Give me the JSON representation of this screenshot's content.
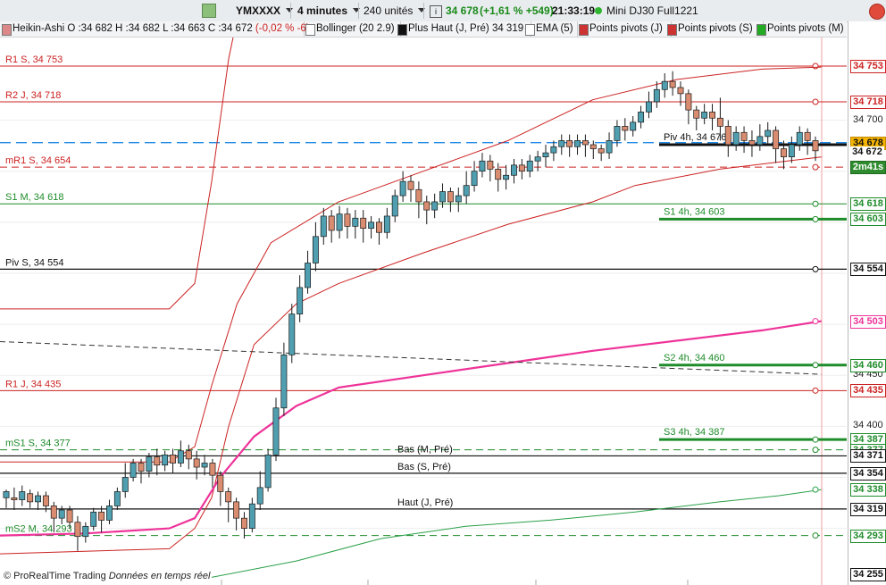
{
  "toolbar": {
    "symbol": "YMXXXX",
    "timeframe": "4 minutes",
    "units": "240 unités",
    "price": "34 678",
    "change": "(+1,61 % +549)",
    "time": "21:33:19",
    "contract": "Mini DJ30 Full1221"
  },
  "indicators": {
    "ha": "Heikin-Ashi O :34 682 H :34 682 L :34 663 C :34 672",
    "ha_change": "(-0,02 % -6)",
    "bollinger": "Bollinger (20 2.9)",
    "plus_haut": "Plus Haut (J, Pré)  34 319",
    "ema": "EMA (5)",
    "pivots_j": "Points pivots (J)",
    "pivots_s": "Points pivots (S)",
    "pivots_m": "Points pivots (M)"
  },
  "footer": {
    "brand": "© ProRealTime Trading",
    "data": "Données en temps réel"
  },
  "colors": {
    "up": "#4f9fb0",
    "down": "#d98c70",
    "red": "#cc2222",
    "green": "#1e8c2a",
    "magenta": "#ee3399",
    "blue": "#1f88e5"
  },
  "chart_data": {
    "type": "candlestick",
    "ylim": [
      34248,
      34790
    ],
    "y_ticks": [
      34700,
      34450,
      34400
    ],
    "levels": [
      {
        "label": "R1 S, 34 753",
        "value": 34753,
        "color": "red",
        "style": "solid"
      },
      {
        "label": "R2 J, 34 718",
        "value": 34718,
        "color": "red",
        "style": "solid"
      },
      {
        "label": "mR1 S, 34 654",
        "value": 34654,
        "color": "red",
        "style": "dashed"
      },
      {
        "label": "S1 M, 34 618",
        "value": 34618,
        "color": "green",
        "style": "solid"
      },
      {
        "label": "Piv S, 34 554",
        "value": 34554,
        "color": "black",
        "style": "solid"
      },
      {
        "label": "R1 J, 34 435",
        "value": 34435,
        "color": "red",
        "style": "solid"
      },
      {
        "label": "mS1 S, 34 377",
        "value": 34377,
        "color": "green",
        "style": "dashed"
      },
      {
        "label": "mS2 M, 34 293",
        "value": 34293,
        "color": "green",
        "style": "dashed"
      },
      {
        "label": "Bas (M, Pré)",
        "value": 34371,
        "color": "black",
        "style": "solid"
      },
      {
        "label": "Bas (S, Pré)",
        "value": 34354,
        "color": "black",
        "style": "solid"
      },
      {
        "label": "Haut (J, Pré)",
        "value": 34319,
        "color": "black",
        "style": "solid"
      }
    ],
    "pivots_4h": [
      {
        "label": "Piv 4h, 34 676",
        "value": 34676,
        "color": "black"
      },
      {
        "label": "S1 4h, 34 603",
        "value": 34603,
        "color": "green"
      },
      {
        "label": "S2 4h, 34 460",
        "value": 34460,
        "color": "green"
      },
      {
        "label": "S3 4h, 34 387",
        "value": 34387,
        "color": "green"
      }
    ],
    "axis_boxes": [
      {
        "text": "34 753",
        "value": 34753,
        "kind": "red"
      },
      {
        "text": "34 718",
        "value": 34718,
        "kind": "red"
      },
      {
        "text": "34 678",
        "value": 34678,
        "kind": "price"
      },
      {
        "text": "34 672",
        "value": 34668,
        "kind": "plain"
      },
      {
        "text": "2m41s",
        "value": 34654,
        "kind": "timer"
      },
      {
        "text": "34 618",
        "value": 34618,
        "kind": "green"
      },
      {
        "text": "34 603",
        "value": 34603,
        "kind": "green"
      },
      {
        "text": "34 554",
        "value": 34554,
        "kind": "black"
      },
      {
        "text": "34 503",
        "value": 34503,
        "kind": "magenta"
      },
      {
        "text": "34 460",
        "value": 34460,
        "kind": "green"
      },
      {
        "text": "34 435",
        "value": 34435,
        "kind": "red"
      },
      {
        "text": "34 387",
        "value": 34387,
        "kind": "green"
      },
      {
        "text": "34 377",
        "value": 34377,
        "kind": "green"
      },
      {
        "text": "34 371",
        "value": 34371,
        "kind": "black"
      },
      {
        "text": "34 354",
        "value": 34354,
        "kind": "black"
      },
      {
        "text": "34 338",
        "value": 34338,
        "kind": "green"
      },
      {
        "text": "34 319",
        "value": 34319,
        "kind": "black"
      },
      {
        "text": "34 293",
        "value": 34293,
        "kind": "green"
      },
      {
        "text": "34 255",
        "value": 34255,
        "kind": "black"
      }
    ],
    "candles": [
      [
        34330,
        34336,
        34320,
        34338
      ],
      [
        34330,
        34328,
        34318,
        34340
      ],
      [
        34328,
        34336,
        34322,
        34342
      ],
      [
        34334,
        34326,
        34320,
        34338
      ],
      [
        34326,
        34332,
        34318,
        34336
      ],
      [
        34332,
        34322,
        34316,
        34336
      ],
      [
        34322,
        34310,
        34296,
        34326
      ],
      [
        34310,
        34318,
        34304,
        34322
      ],
      [
        34318,
        34306,
        34300,
        34322
      ],
      [
        34306,
        34292,
        34278,
        34312
      ],
      [
        34292,
        34302,
        34286,
        34306
      ],
      [
        34302,
        34316,
        34298,
        34320
      ],
      [
        34316,
        34308,
        34296,
        34322
      ],
      [
        34308,
        34322,
        34304,
        34328
      ],
      [
        34322,
        34336,
        34318,
        34340
      ],
      [
        34336,
        34350,
        34330,
        34364
      ],
      [
        34350,
        34364,
        34346,
        34368
      ],
      [
        34364,
        34356,
        34344,
        34368
      ],
      [
        34356,
        34370,
        34350,
        34374
      ],
      [
        34370,
        34362,
        34352,
        34378
      ],
      [
        34362,
        34372,
        34356,
        34376
      ],
      [
        34372,
        34364,
        34354,
        34378
      ],
      [
        34364,
        34376,
        34360,
        34386
      ],
      [
        34376,
        34368,
        34358,
        34382
      ],
      [
        34368,
        34360,
        34348,
        34376
      ],
      [
        34360,
        34364,
        34352,
        34372
      ],
      [
        34364,
        34352,
        34340,
        34368
      ],
      [
        34352,
        34336,
        34322,
        34356
      ],
      [
        34336,
        34326,
        34306,
        34340
      ],
      [
        34326,
        34310,
        34298,
        34330
      ],
      [
        34310,
        34300,
        34290,
        34316
      ],
      [
        34300,
        34324,
        34296,
        34330
      ],
      [
        34324,
        34340,
        34318,
        34356
      ],
      [
        34340,
        34372,
        34336,
        34378
      ],
      [
        34372,
        34418,
        34366,
        34428
      ],
      [
        34418,
        34470,
        34410,
        34482
      ],
      [
        34470,
        34510,
        34462,
        34520
      ],
      [
        34510,
        34536,
        34502,
        34548
      ],
      [
        34536,
        34560,
        34530,
        34572
      ],
      [
        34560,
        34586,
        34552,
        34600
      ],
      [
        34586,
        34606,
        34578,
        34614
      ],
      [
        34606,
        34592,
        34580,
        34612
      ],
      [
        34592,
        34608,
        34584,
        34616
      ],
      [
        34608,
        34596,
        34584,
        34614
      ],
      [
        34596,
        34604,
        34584,
        34612
      ],
      [
        34604,
        34594,
        34580,
        34612
      ],
      [
        34594,
        34600,
        34584,
        34606
      ],
      [
        34600,
        34590,
        34578,
        34604
      ],
      [
        34590,
        34606,
        34584,
        34614
      ],
      [
        34606,
        34626,
        34600,
        34632
      ],
      [
        34626,
        34640,
        34620,
        34650
      ],
      [
        34640,
        34632,
        34620,
        34646
      ],
      [
        34632,
        34620,
        34604,
        34640
      ],
      [
        34620,
        34612,
        34598,
        34626
      ],
      [
        34612,
        34620,
        34604,
        34628
      ],
      [
        34620,
        34630,
        34614,
        34638
      ],
      [
        34630,
        34620,
        34610,
        34634
      ],
      [
        34620,
        34626,
        34610,
        34634
      ],
      [
        34626,
        34636,
        34618,
        34650
      ],
      [
        34636,
        34650,
        34630,
        34660
      ],
      [
        34650,
        34660,
        34644,
        34668
      ],
      [
        34660,
        34652,
        34640,
        34666
      ],
      [
        34652,
        34642,
        34630,
        34658
      ],
      [
        34642,
        34646,
        34632,
        34656
      ],
      [
        34646,
        34656,
        34638,
        34662
      ],
      [
        34656,
        34650,
        34642,
        34662
      ],
      [
        34650,
        34660,
        34644,
        34666
      ],
      [
        34660,
        34664,
        34650,
        34670
      ],
      [
        34664,
        34668,
        34654,
        34676
      ],
      [
        34668,
        34674,
        34660,
        34680
      ],
      [
        34674,
        34680,
        34666,
        34686
      ],
      [
        34680,
        34674,
        34664,
        34686
      ],
      [
        34674,
        34680,
        34666,
        34686
      ],
      [
        34680,
        34676,
        34664,
        34686
      ],
      [
        34676,
        34672,
        34662,
        34680
      ],
      [
        34672,
        34668,
        34660,
        34676
      ],
      [
        34668,
        34680,
        34662,
        34688
      ],
      [
        34680,
        34694,
        34674,
        34700
      ],
      [
        34694,
        34690,
        34680,
        34702
      ],
      [
        34690,
        34698,
        34684,
        34704
      ],
      [
        34698,
        34708,
        34692,
        34714
      ],
      [
        34708,
        34718,
        34702,
        34728
      ],
      [
        34718,
        34730,
        34712,
        34738
      ],
      [
        34730,
        34738,
        34722,
        34746
      ],
      [
        34738,
        34732,
        34724,
        34748
      ],
      [
        34732,
        34726,
        34714,
        34738
      ],
      [
        34726,
        34710,
        34696,
        34730
      ],
      [
        34710,
        34702,
        34690,
        34714
      ],
      [
        34702,
        34708,
        34696,
        34716
      ],
      [
        34708,
        34702,
        34690,
        34716
      ],
      [
        34702,
        34694,
        34680,
        34722
      ],
      [
        34694,
        34676,
        34664,
        34700
      ],
      [
        34676,
        34688,
        34670,
        34694
      ],
      [
        34688,
        34680,
        34668,
        34694
      ],
      [
        34680,
        34676,
        34664,
        34690
      ],
      [
        34676,
        34684,
        34670,
        34696
      ],
      [
        34684,
        34690,
        34676,
        34698
      ],
      [
        34690,
        34672,
        34658,
        34694
      ],
      [
        34672,
        34664,
        34652,
        34680
      ],
      [
        34664,
        34676,
        34658,
        34684
      ],
      [
        34676,
        34688,
        34670,
        34694
      ],
      [
        34688,
        34680,
        34666,
        34692
      ],
      [
        34680,
        34670,
        34660,
        34684
      ]
    ],
    "bollinger_upper": [
      [
        0,
        34515
      ],
      [
        0.2,
        34515
      ],
      [
        0.23,
        34540
      ],
      [
        0.25,
        34640
      ],
      [
        0.27,
        34760
      ],
      [
        0.3,
        34880
      ],
      [
        0.32,
        34980
      ],
      [
        0.35,
        35060
      ],
      [
        0.4,
        35140
      ],
      [
        0.5,
        35190
      ],
      [
        0.6,
        35220
      ],
      [
        0.65,
        35236
      ]
    ],
    "bollinger_middle": [
      [
        0,
        34365
      ],
      [
        0.2,
        34365
      ],
      [
        0.23,
        34380
      ],
      [
        0.25,
        34440
      ],
      [
        0.28,
        34520
      ],
      [
        0.32,
        34580
      ],
      [
        0.4,
        34620
      ],
      [
        0.5,
        34650
      ],
      [
        0.6,
        34680
      ],
      [
        0.65,
        34700
      ],
      [
        0.7,
        34720
      ],
      [
        0.8,
        34740
      ],
      [
        0.9,
        34750
      ],
      [
        0.97,
        34752
      ]
    ],
    "bollinger_lower": [
      [
        0,
        34275
      ],
      [
        0.2,
        34280
      ],
      [
        0.23,
        34300
      ],
      [
        0.25,
        34330
      ],
      [
        0.27,
        34400
      ],
      [
        0.3,
        34480
      ],
      [
        0.35,
        34520
      ],
      [
        0.4,
        34540
      ],
      [
        0.5,
        34570
      ],
      [
        0.6,
        34598
      ],
      [
        0.7,
        34620
      ],
      [
        0.75,
        34636
      ],
      [
        0.85,
        34652
      ],
      [
        0.95,
        34662
      ],
      [
        0.97,
        34664
      ]
    ],
    "ema_long": [
      [
        0,
        34293
      ],
      [
        0.1,
        34295
      ],
      [
        0.2,
        34300
      ],
      [
        0.23,
        34310
      ],
      [
        0.26,
        34350
      ],
      [
        0.3,
        34390
      ],
      [
        0.35,
        34420
      ],
      [
        0.4,
        34438
      ],
      [
        0.5,
        34450
      ],
      [
        0.6,
        34462
      ],
      [
        0.7,
        34474
      ],
      [
        0.8,
        34484
      ],
      [
        0.9,
        34494
      ],
      [
        0.97,
        34503
      ]
    ],
    "ema_very_long": [
      [
        0.25,
        34252
      ],
      [
        0.35,
        34268
      ],
      [
        0.45,
        34290
      ],
      [
        0.55,
        34302
      ],
      [
        0.65,
        34308
      ],
      [
        0.75,
        34316
      ],
      [
        0.85,
        34326
      ],
      [
        0.92,
        34332
      ],
      [
        0.97,
        34338
      ]
    ],
    "trendline": [
      [
        0,
        34483
      ],
      [
        0.97,
        34451
      ]
    ]
  }
}
